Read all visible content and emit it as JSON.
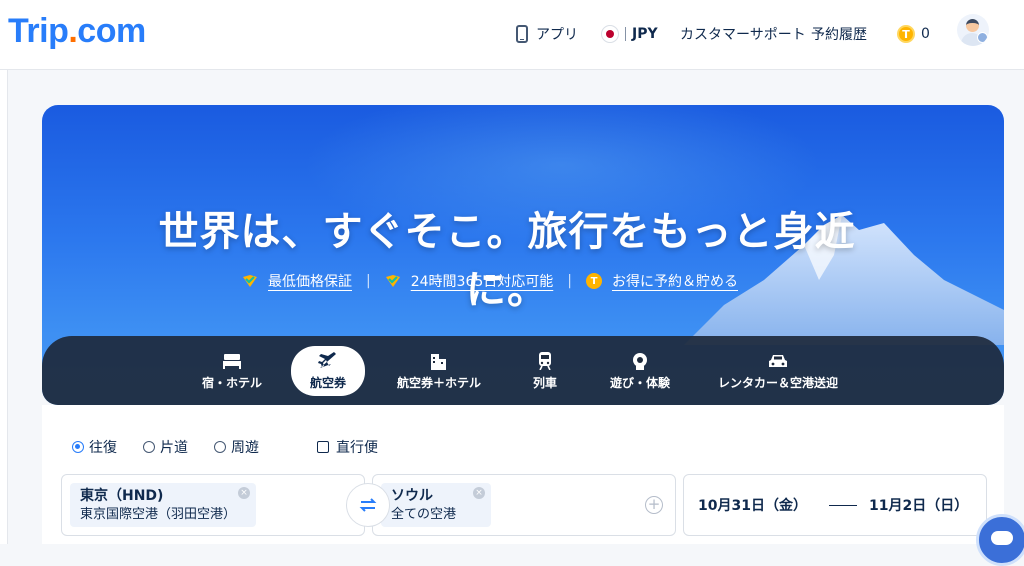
{
  "header": {
    "logo_main": "Trip",
    "logo_dot": ".",
    "logo_tld": "com",
    "app_label": "アプリ",
    "currency": "JPY",
    "support": "カスタマーサポート",
    "history": "予約履歴",
    "points_value": "0",
    "points_coin_letter": "T"
  },
  "hero": {
    "title": "世界は、すぐそこ。旅行をもっと身近に。",
    "features": [
      {
        "label": "最低価格保証",
        "icon": "check-badge-icon"
      },
      {
        "label": "24時間365日対応可能",
        "icon": "check-badge-icon"
      },
      {
        "label": "お得に予約＆貯める",
        "icon": "coin-icon"
      }
    ],
    "separator": "|"
  },
  "tabs": [
    {
      "label": "宿・ホテル",
      "icon": "bed-icon"
    },
    {
      "label": "航空券",
      "icon": "plane-icon",
      "active": true
    },
    {
      "label": "航空券＋ホテル",
      "icon": "building-icon"
    },
    {
      "label": "列車",
      "icon": "train-icon"
    },
    {
      "label": "遊び・体験",
      "icon": "attraction-icon"
    },
    {
      "label": "レンタカー＆空港送迎",
      "icon": "car-icon"
    }
  ],
  "search": {
    "trip_types": [
      {
        "label": "往復",
        "selected": true
      },
      {
        "label": "片道",
        "selected": false
      },
      {
        "label": "周遊",
        "selected": false
      }
    ],
    "direct_only": {
      "label": "直行便",
      "checked": false
    },
    "origin": {
      "city": "東京（HND)",
      "airport": "東京国際空港（羽田空港）"
    },
    "destination": {
      "city": "ソウル",
      "airport": "全ての空港"
    },
    "depart_date": "10月31日（金）",
    "return_date": "11月2日（日）"
  },
  "colors": {
    "brand_blue": "#287dfa",
    "brand_orange": "#ff6f00",
    "text_dark": "#0f294d",
    "coin_yellow": "#ffb400"
  }
}
